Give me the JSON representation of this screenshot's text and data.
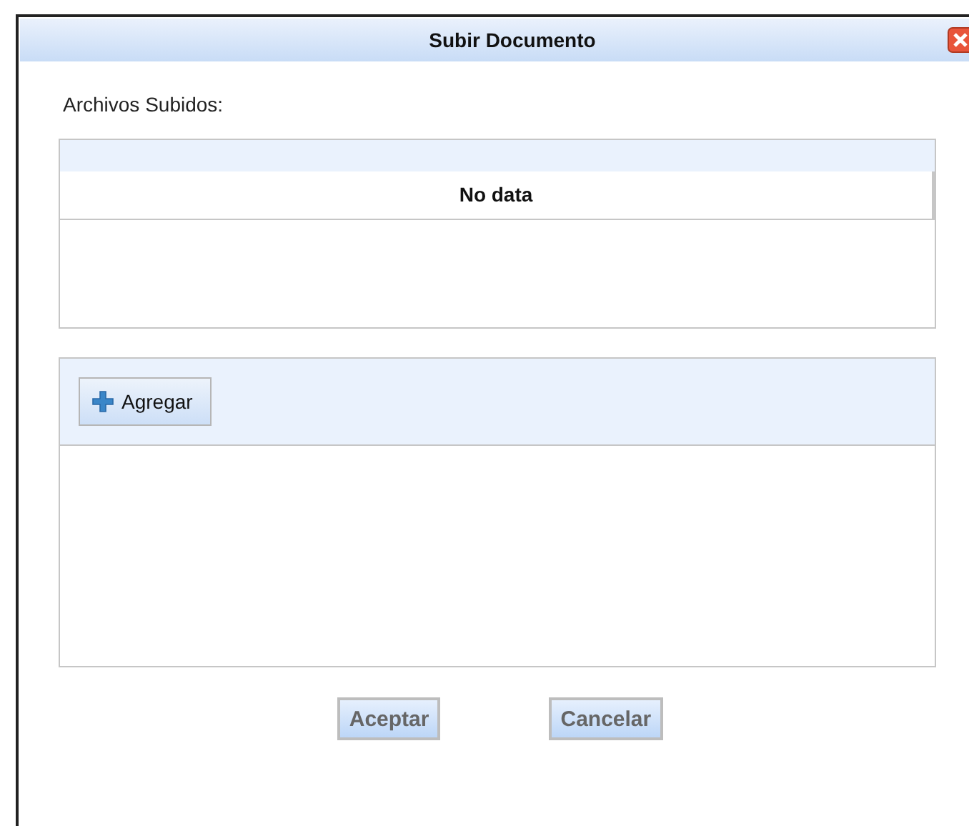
{
  "window": {
    "title": "Subir Documento"
  },
  "uploaded_files": {
    "label": "Archivos Subidos:",
    "empty_text": "No data"
  },
  "upload_panel": {
    "add_button": "Agregar"
  },
  "buttons": [
    "Aceptar",
    "Cancelar"
  ]
}
